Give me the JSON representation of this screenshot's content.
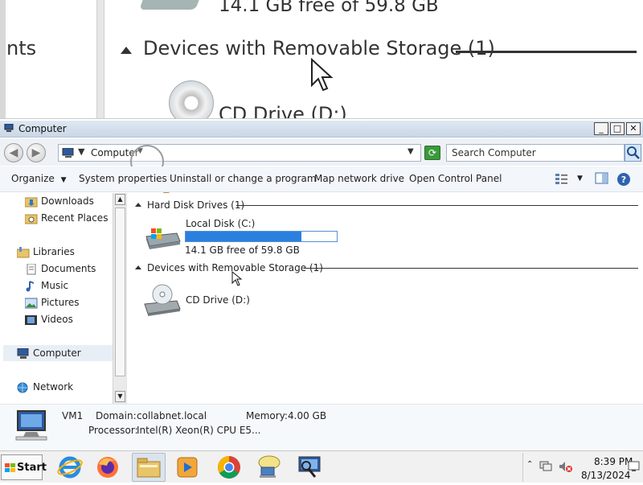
{
  "zoom": {
    "left_fragment": "nts",
    "free_fragment": "14.1 GB free of 59.8 GB",
    "group_text": "Devices with Removable Storage (1)",
    "cd_fragment": "CD Drive (D:)"
  },
  "window": {
    "title": "Computer",
    "controls": {
      "minimize": "_",
      "maximize": "□",
      "close": "✕"
    }
  },
  "address": {
    "crumb": "Computer",
    "search_placeholder": "Search Computer"
  },
  "toolbar": {
    "organize": "Organize",
    "system_properties": "System properties",
    "uninstall": "Uninstall or change a program",
    "map_drive": "Map network drive",
    "control_panel": "Open Control Panel"
  },
  "nav": {
    "downloads": "Downloads",
    "recent_places": "Recent Places",
    "libraries": "Libraries",
    "documents": "Documents",
    "music": "Music",
    "pictures": "Pictures",
    "videos": "Videos",
    "computer": "Computer",
    "network": "Network"
  },
  "content": {
    "hdd_group": "Hard Disk Drives (1)",
    "local_disk": {
      "name": "Local Disk (C:)",
      "free_text": "14.1 GB free of 59.8 GB",
      "used_fraction": 0.764
    },
    "removable_group": "Devices with Removable Storage (1)",
    "cd_drive": "CD Drive (D:)"
  },
  "details": {
    "name": "VM1",
    "domain_label": "Domain:",
    "domain_value": "collabnet.local",
    "memory_label": "Memory:",
    "memory_value": "4.00 GB",
    "processor_label": "Processor:",
    "processor_value": "Intel(R) Xeon(R) CPU E5..."
  },
  "taskbar": {
    "start_label": "Start",
    "time": "8:39 PM",
    "date": "8/13/2024",
    "apps": [
      "internet-explorer-icon",
      "firefox-icon",
      "file-explorer-icon",
      "media-player-icon",
      "chrome-icon",
      "network-user-icon",
      "computer-app-icon"
    ]
  },
  "colors": {
    "progress_fill": "#2a80e0",
    "title_bar": "#c9d7e6"
  }
}
